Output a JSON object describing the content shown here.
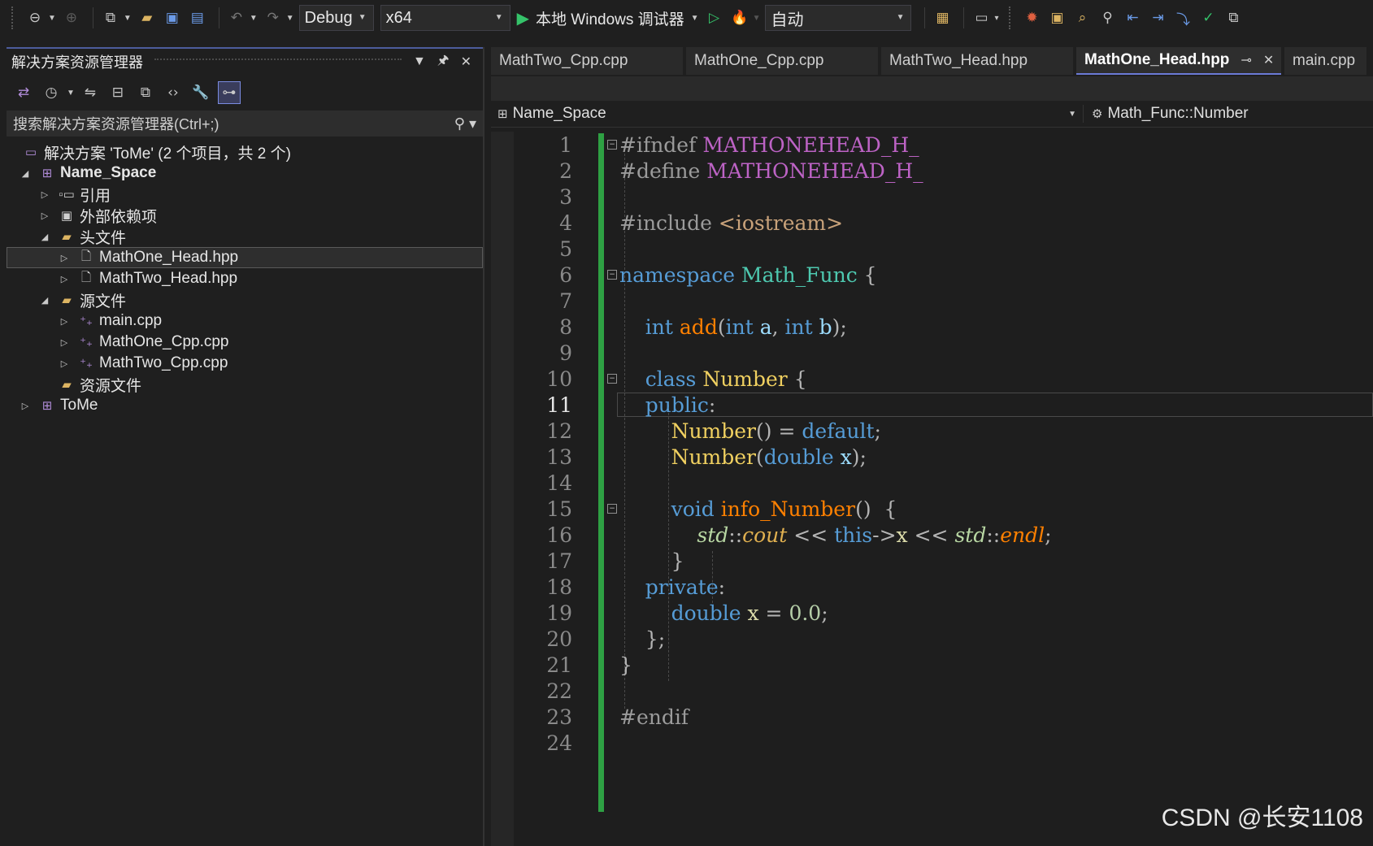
{
  "toolbar": {
    "config": "Debug",
    "platform": "x64",
    "run_label": "本地 Windows 调试器",
    "mode": "自动"
  },
  "explorer": {
    "title": "解决方案资源管理器",
    "search_placeholder": "搜索解决方案资源管理器(Ctrl+;)",
    "tree": [
      {
        "label": "解决方案 'ToMe' (2 个项目，共 2 个)"
      },
      {
        "label": "Name_Space"
      },
      {
        "label": "引用"
      },
      {
        "label": "外部依赖项"
      },
      {
        "label": "头文件"
      },
      {
        "label": "MathOne_Head.hpp"
      },
      {
        "label": "MathTwo_Head.hpp"
      },
      {
        "label": "源文件"
      },
      {
        "label": "main.cpp"
      },
      {
        "label": "MathOne_Cpp.cpp"
      },
      {
        "label": "MathTwo_Cpp.cpp"
      },
      {
        "label": "资源文件"
      },
      {
        "label": "ToMe"
      }
    ]
  },
  "editor": {
    "tabs": [
      "MathTwo_Cpp.cpp",
      "MathOne_Cpp.cpp",
      "MathTwo_Head.hpp",
      "MathOne_Head.hpp",
      "main.cpp"
    ],
    "active_tab": 3,
    "scope": "Name_Space",
    "member": "Math_Func::Number",
    "current_line": 11,
    "line_numbers": [
      "1",
      "2",
      "3",
      "4",
      "5",
      "6",
      "7",
      "8",
      "9",
      "10",
      "11",
      "12",
      "13",
      "14",
      "15",
      "16",
      "17",
      "18",
      "19",
      "20",
      "21",
      "22",
      "23",
      "24"
    ]
  },
  "watermark": "CSDN @长安1108",
  "colors": {
    "keyword": "#569cd6",
    "class": "#f0d060",
    "macro": "#bd63c5",
    "changed_bar": "#2ea043"
  }
}
